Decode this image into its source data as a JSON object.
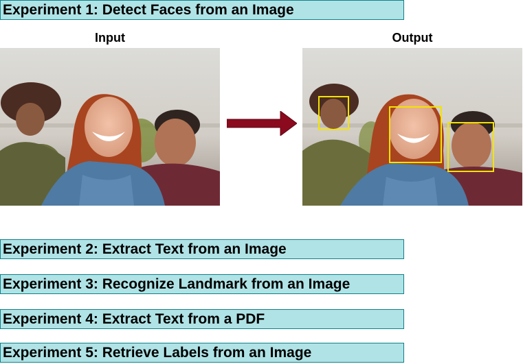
{
  "experiments": [
    {
      "label": "Experiment 1: Detect Faces from an Image"
    },
    {
      "label": "Experiment 2: Extract Text from an Image"
    },
    {
      "label": "Experiment 3: Recognize Landmark from an Image"
    },
    {
      "label": "Experiment 4: Extract Text from a PDF"
    },
    {
      "label": "Experiment 5: Retrieve Labels from an Image"
    }
  ],
  "diagram": {
    "input_label": "Input",
    "output_label": "Output"
  },
  "colors": {
    "banner_fill": "#b0e3e6",
    "banner_border": "#0e8088",
    "arrow": "#8b0a1e",
    "face_box": "#f4e300"
  }
}
